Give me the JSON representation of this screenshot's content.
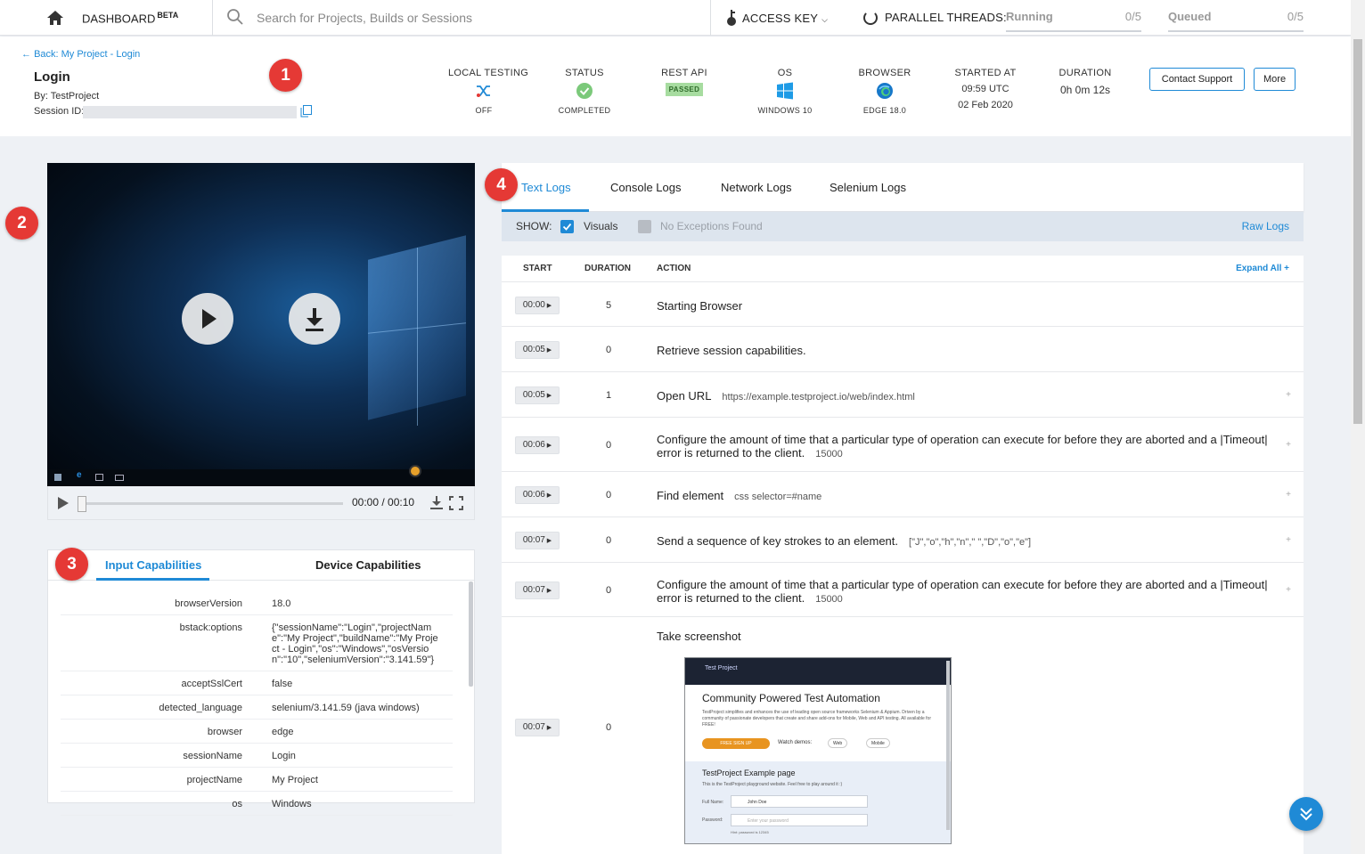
{
  "nav": {
    "dashboard_label": "DASHBOARD",
    "dashboard_badge": "BETA",
    "search_placeholder": "Search for Projects, Builds or Sessions",
    "access_key_label": "ACCESS KEY",
    "parallel_threads_label": "PARALLEL THREADS:",
    "running_label": "Running",
    "running_value": "0/5",
    "queued_label": "Queued",
    "queued_value": "0/5"
  },
  "session": {
    "back_link": "Back: My Project - Login",
    "title": "Login",
    "by": "By: TestProject",
    "session_id_label": "Session ID:"
  },
  "meta": {
    "local_testing_label": "LOCAL TESTING",
    "local_testing_value": "OFF",
    "status_label": "STATUS",
    "status_value": "COMPLETED",
    "rest_api_label": "REST API",
    "rest_api_value": "PASSED",
    "os_label": "OS",
    "os_value": "WINDOWS 10",
    "browser_label": "BROWSER",
    "browser_value": "EDGE 18.0",
    "started_label": "STARTED AT",
    "started_time": "09:59 UTC",
    "started_date": "02 Feb 2020",
    "duration_label": "DURATION",
    "duration_value": "0h 0m 12s"
  },
  "actions": {
    "contact_support": "Contact Support",
    "more": "More"
  },
  "badges": [
    "1",
    "2",
    "3",
    "4"
  ],
  "video": {
    "time": "00:00 / 00:10",
    "progress": 0
  },
  "capabilities": {
    "tabs": [
      "Input Capabilities",
      "Device Capabilities"
    ],
    "rows": [
      {
        "key": "browserVersion",
        "value": "18.0"
      },
      {
        "key": "bstack:options",
        "value": "{\"sessionName\":\"Login\",\"projectName\":\"My Project\",\"buildName\":\"My Project - Login\",\"os\":\"Windows\",\"osVersion\":\"10\",\"seleniumVersion\":\"3.141.59\"}"
      },
      {
        "key": "acceptSslCert",
        "value": "false"
      },
      {
        "key": "detected_language",
        "value": "selenium/3.141.59 (java windows)"
      },
      {
        "key": "browser",
        "value": "edge"
      },
      {
        "key": "sessionName",
        "value": "Login"
      },
      {
        "key": "projectName",
        "value": "My Project"
      },
      {
        "key": "os",
        "value": "Windows"
      }
    ]
  },
  "logs": {
    "tabs": [
      "Text Logs",
      "Console Logs",
      "Network Logs",
      "Selenium Logs"
    ],
    "show_label": "SHOW:",
    "visuals_label": "Visuals",
    "no_exceptions_label": "No Exceptions Found",
    "raw_logs": "Raw Logs",
    "columns": {
      "start": "START",
      "duration": "DURATION",
      "action": "ACTION",
      "expand_all": "Expand All +"
    },
    "rows": [
      {
        "start": "00:00",
        "duration": "5",
        "action": "Starting Browser",
        "detail": "",
        "expandable": false
      },
      {
        "start": "00:05",
        "duration": "0",
        "action": "Retrieve session capabilities.",
        "detail": "",
        "expandable": false
      },
      {
        "start": "00:05",
        "duration": "1",
        "action": "Open URL",
        "detail": "https://example.testproject.io/web/index.html",
        "expandable": true
      },
      {
        "start": "00:06",
        "duration": "0",
        "action": "Configure the amount of time that a particular type of operation can execute for before they are aborted and a |Timeout| error is returned to the client.",
        "detail": "15000",
        "expandable": true
      },
      {
        "start": "00:06",
        "duration": "0",
        "action": "Find element",
        "detail": "css selector=#name",
        "expandable": true
      },
      {
        "start": "00:07",
        "duration": "0",
        "action": "Send a sequence of key strokes to an element.",
        "detail": "[\"J\",\"o\",\"h\",\"n\",\" \",\"D\",\"o\",\"e\"]",
        "expandable": true
      },
      {
        "start": "00:07",
        "duration": "0",
        "action": "Configure the amount of time that a particular type of operation can execute for before they are aborted and a |Timeout| error is returned to the client.",
        "detail": "15000",
        "expandable": true
      },
      {
        "start": "00:07",
        "duration": "0",
        "action": "Take screenshot",
        "detail": "",
        "expandable": false
      }
    ]
  },
  "screenshot": {
    "logo": "Test Project",
    "heading": "Community Powered Test Automation",
    "body": "TestProject simplifies and enhances the use of leading open source frameworks Selenium & Appium. Driven by a community of passionate developers that create and share add-ons for Mobile, Web and API testing. All available for FREE!",
    "signup": "FREE SIGN UP",
    "watch_demos": "Watch demos:",
    "demo_web": "Web",
    "demo_mobile": "Mobile",
    "example_title": "TestProject Example page",
    "example_sub": "This is the TestProject playground website. Feel free to play around it :)",
    "full_name_label": "Full Name:",
    "full_name_value": "John Doe",
    "password_label": "Password:",
    "password_placeholder": "Enter your password",
    "hint": "Hint: password is 12345"
  }
}
